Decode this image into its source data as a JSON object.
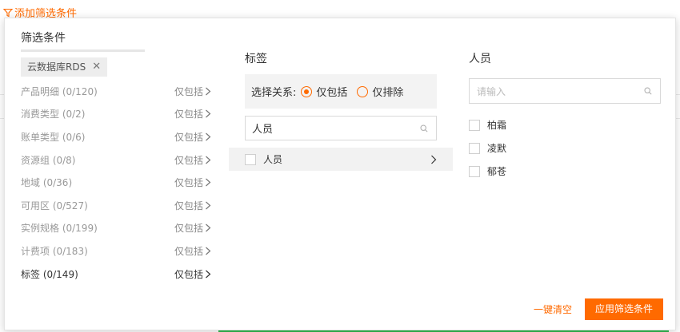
{
  "top_link": {
    "label": "添加筛选条件"
  },
  "panel": {
    "categories_title": "筛选条件",
    "selected_chip": "云数据库RDS",
    "categories": [
      {
        "label": "产品明细 (0/120)",
        "op": "仅包括",
        "active": false
      },
      {
        "label": "消费类型 (0/2)",
        "op": "仅包括",
        "active": false
      },
      {
        "label": "账单类型 (0/6)",
        "op": "仅包括",
        "active": false
      },
      {
        "label": "资源组 (0/8)",
        "op": "仅包括",
        "active": false
      },
      {
        "label": "地域 (0/36)",
        "op": "仅包括",
        "active": false
      },
      {
        "label": "可用区 (0/527)",
        "op": "仅包括",
        "active": false
      },
      {
        "label": "实例规格 (0/199)",
        "op": "仅包括",
        "active": false
      },
      {
        "label": "计费项 (0/183)",
        "op": "仅包括",
        "active": false
      },
      {
        "label": "标签 (0/149)",
        "op": "仅包括",
        "active": true
      }
    ],
    "tags": {
      "title": "标签",
      "relation_label": "选择关系:",
      "include_label": "仅包括",
      "exclude_label": "仅排除",
      "selected_relation": "include",
      "search_value": "人员",
      "tag_item": "人员"
    },
    "persons": {
      "title": "人员",
      "search_placeholder": "请输入",
      "items": [
        "柏霜",
        "凌默",
        "郁苍"
      ]
    },
    "footer": {
      "clear_label": "一键清空",
      "apply_label": "应用筛选条件"
    }
  },
  "colors": {
    "accent": "#ff6a00"
  }
}
